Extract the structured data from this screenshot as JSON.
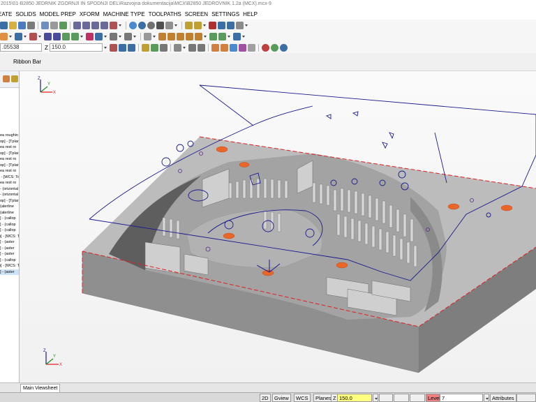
{
  "window": {
    "title": "2015\\01-B2850 JEDRNIK ZGORNJI IN SPODNJI DEL\\Razvojna dokumentacija\\MCX\\B2850 JEDROVNIK 1.2a (MCX).mcx-9"
  },
  "menu": [
    "EATE",
    "SOLIDS",
    "MODEL PREP",
    "XFORM",
    "MACHINE TYPE",
    "TOOLPATHS",
    "SCREEN",
    "SETTINGS",
    "HELP"
  ],
  "toolbar": {
    "coord_value": ".05538",
    "z_label": "Z",
    "z_value": "150.0"
  },
  "ribbon": {
    "label": "Ribbon Bar"
  },
  "operations_list": [
    "ea roughin",
    "op] - [Tplar",
    "ea rest ro",
    "op] - [Tplar",
    "ea rest ro",
    "op] - [Tplar",
    "ea rest ro",
    "op] - [WCS: To",
    "ea rest ro",
    "orizontal) -",
    "orizontal) -",
    "op] - [Tplar",
    "aterline)",
    "aterline)",
    "callop) - [",
    "callop) - [",
    "callop) - [",
    "op] - [WCS: T",
    "aster) - [",
    "aster) - [",
    "aster) - [",
    "callop) - [",
    "op] - [WCS: T",
    "aster) - ["
  ],
  "viewsheet": {
    "tab_label": "Main Viewsheet"
  },
  "statusbar": {
    "mode_2d": "2D",
    "gview": "Gview",
    "wcs": "WCS",
    "planes": "Planes",
    "z_label": "Z",
    "z_value": "150.0",
    "level_label": "Level",
    "level_value": "7",
    "attributes": "Attributes"
  },
  "colors": {
    "part_gray": "#a8a8a8",
    "part_top": "#bcbcbc",
    "part_side": "#8f8f8f",
    "edge_red": "#e02020",
    "toolpath_blue": "#1a1a8c",
    "marker_orange": "#e8662a",
    "level_field": "#f08080",
    "z_field": "#ffff80"
  },
  "axis": {
    "x": "X",
    "y": "Y",
    "z": "Z"
  }
}
